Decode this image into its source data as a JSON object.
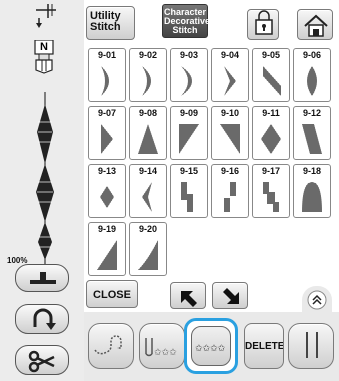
{
  "header": {
    "utility_label": "Utility\nStitch",
    "character_label_lines": [
      "Character",
      "Decorative",
      "Stitch"
    ]
  },
  "left_panel": {
    "presser_foot_letter": "N",
    "zoom_label": "100%"
  },
  "stitch_grid": {
    "cells": [
      {
        "code": "9-01",
        "shape": "crescent-right"
      },
      {
        "code": "9-02",
        "shape": "crescent-right2"
      },
      {
        "code": "9-03",
        "shape": "crescent-right3"
      },
      {
        "code": "9-04",
        "shape": "chevron"
      },
      {
        "code": "9-05",
        "shape": "wedge-diag"
      },
      {
        "code": "9-06",
        "shape": "ellipse"
      },
      {
        "code": "9-07",
        "shape": "half-tri"
      },
      {
        "code": "9-08",
        "shape": "triangle"
      },
      {
        "code": "9-09",
        "shape": "tri-left"
      },
      {
        "code": "9-10",
        "shape": "tri-right"
      },
      {
        "code": "9-11",
        "shape": "diamond"
      },
      {
        "code": "9-12",
        "shape": "slant"
      },
      {
        "code": "9-13",
        "shape": "diamond-small"
      },
      {
        "code": "9-14",
        "shape": "chevron-left"
      },
      {
        "code": "9-15",
        "shape": "steps"
      },
      {
        "code": "9-16",
        "shape": "steps2"
      },
      {
        "code": "9-17",
        "shape": "dots-step"
      },
      {
        "code": "9-18",
        "shape": "dome"
      },
      {
        "code": "9-19",
        "shape": "ramp"
      },
      {
        "code": "9-20",
        "shape": "ramp2"
      }
    ]
  },
  "controls": {
    "close_label": "CLOSE",
    "delete_label": "DELETE"
  }
}
